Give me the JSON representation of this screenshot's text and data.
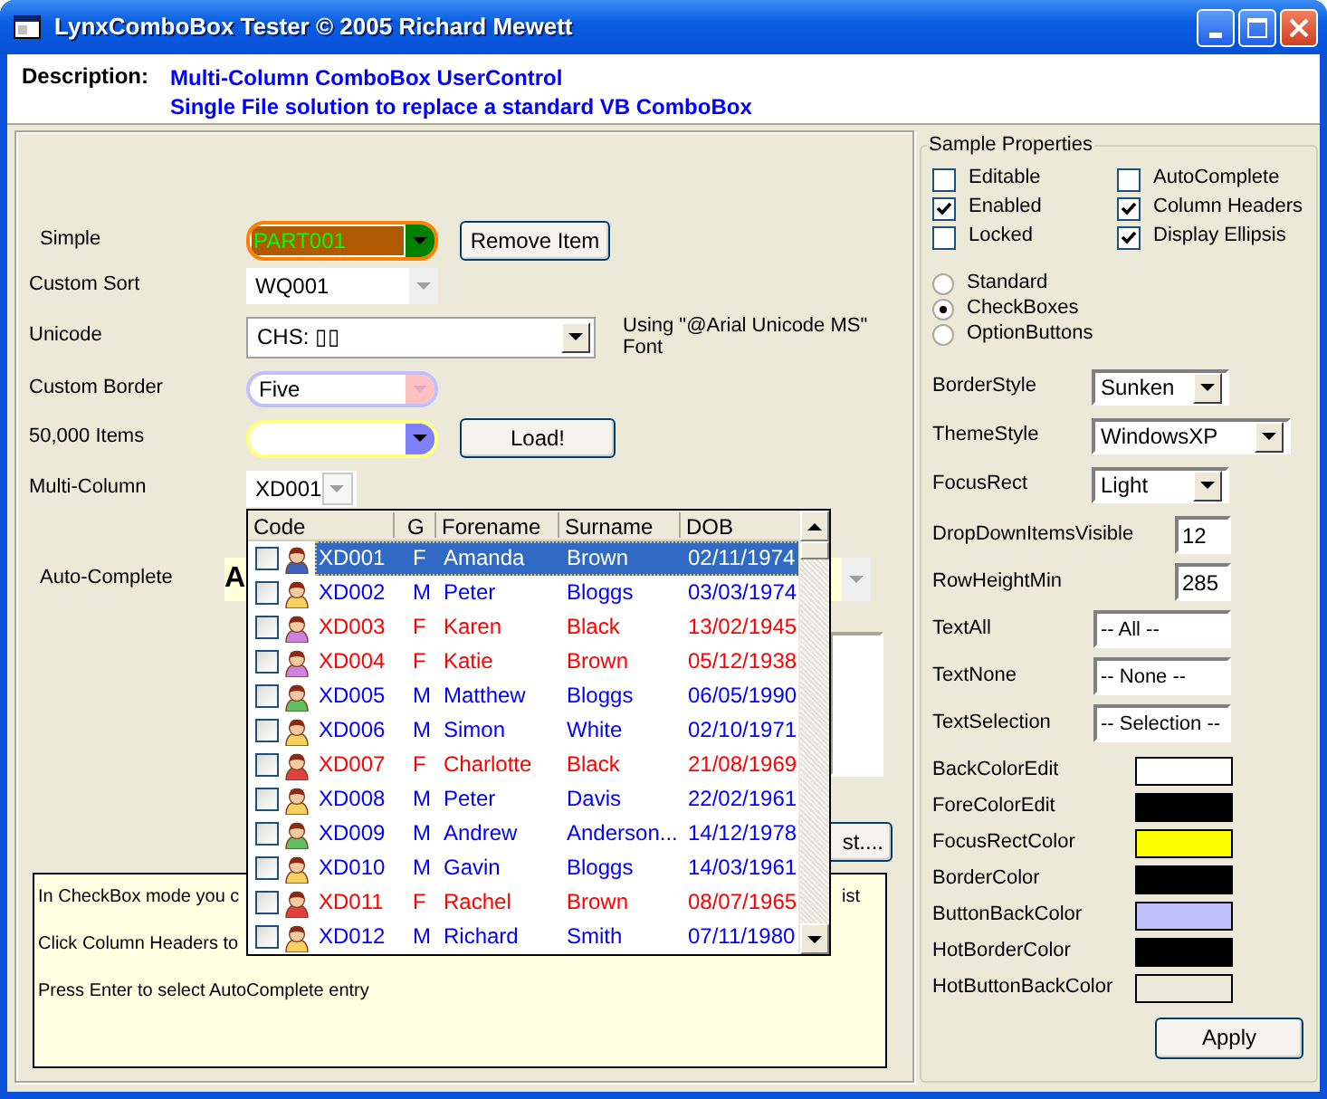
{
  "window": {
    "title": "LynxComboBox Tester © 2005 Richard Mewett"
  },
  "description": {
    "label": "Description:",
    "lines": [
      "Multi-Column ComboBox UserControl",
      "Single File solution to replace a standard VB ComboBox"
    ]
  },
  "combos": [
    {
      "kind": "simple",
      "label": "Simple",
      "value": "PART001",
      "button": "Remove Item"
    },
    {
      "kind": "sort",
      "label": "Custom Sort",
      "value": "WQ001"
    },
    {
      "kind": "unicode",
      "label": "Unicode",
      "value": "CHS: ▯▯",
      "note": "Using \"@Arial Unicode MS\" Font"
    },
    {
      "kind": "border",
      "label": "Custom Border",
      "value": "Five"
    },
    {
      "kind": "items",
      "label": "50,000 Items",
      "button": "Load!"
    },
    {
      "kind": "multi",
      "label": "Multi-Column",
      "value": "XD001"
    }
  ],
  "auto_complete": {
    "label": "Auto-Complete",
    "value": "A"
  },
  "dropdown": {
    "columns": [
      "Code",
      "G",
      "Forename",
      "Surname",
      "DOB"
    ],
    "rows": [
      {
        "code": "XD001",
        "g": "F",
        "forename": "Amanda",
        "surname": "Brown",
        "dob": "02/11/1974",
        "checked": false,
        "selected": true
      },
      {
        "code": "XD002",
        "g": "M",
        "forename": "Peter",
        "surname": "Bloggs",
        "dob": "03/03/1974",
        "color": "#0000ff",
        "checked": false,
        "selected": false
      },
      {
        "code": "XD003",
        "g": "F",
        "forename": "Karen",
        "surname": "Black",
        "dob": "13/02/1945",
        "color": "#ff0000",
        "checked": false,
        "selected": false
      },
      {
        "code": "XD004",
        "g": "F",
        "forename": "Katie",
        "surname": "Brown",
        "dob": "05/12/1938",
        "color": "#ff0000",
        "checked": false,
        "selected": false
      },
      {
        "code": "XD005",
        "g": "M",
        "forename": "Matthew",
        "surname": "Bloggs",
        "dob": "06/05/1990",
        "color": "#0000ff",
        "checked": false,
        "selected": false
      },
      {
        "code": "XD006",
        "g": "M",
        "forename": "Simon",
        "surname": "White",
        "dob": "02/10/1971",
        "color": "#0000ff",
        "checked": false,
        "selected": false
      },
      {
        "code": "XD007",
        "g": "F",
        "forename": "Charlotte",
        "surname": "Black",
        "dob": "21/08/1969",
        "color": "#ff0000",
        "checked": false,
        "selected": false
      },
      {
        "code": "XD008",
        "g": "M",
        "forename": "Peter",
        "surname": "Davis",
        "dob": "22/02/1961",
        "color": "#0000ff",
        "checked": false,
        "selected": false
      },
      {
        "code": "XD009",
        "g": "M",
        "forename": "Andrew",
        "surname": "Anderson...",
        "dob": "14/12/1978",
        "color": "#0000ff",
        "checked": false,
        "selected": false
      },
      {
        "code": "XD010",
        "g": "M",
        "forename": "Gavin",
        "surname": "Bloggs",
        "dob": "14/03/1961",
        "color": "#0000ff",
        "checked": false,
        "selected": false
      },
      {
        "code": "XD011",
        "g": "F",
        "forename": "Rachel",
        "surname": "Brown",
        "dob": "08/07/1965",
        "color": "#ff0000",
        "checked": false,
        "selected": false
      },
      {
        "code": "XD012",
        "g": "M",
        "forename": "Richard",
        "surname": "Smith",
        "dob": "07/11/1980",
        "color": "#0000ff",
        "checked": false,
        "selected": false
      }
    ]
  },
  "hidden_button": "st....",
  "notes": [
    {
      "left": "In CheckBox mode you c",
      "right": "ist"
    },
    {
      "left": "Click Column Headers to"
    },
    {
      "left": "Press Enter to select AutoComplete entry"
    }
  ],
  "properties": {
    "title": "Sample Properties",
    "checkboxes": [
      {
        "label": "Editable",
        "checked": false
      },
      {
        "label": "AutoComplete",
        "checked": false
      },
      {
        "label": "Enabled",
        "checked": true
      },
      {
        "label": "Column Headers",
        "checked": true
      },
      {
        "label": "Locked",
        "checked": false
      },
      {
        "label": "Display Ellipsis",
        "checked": true
      }
    ],
    "radios": [
      {
        "label": "Standard",
        "selected": false
      },
      {
        "label": "CheckBoxes",
        "selected": true
      },
      {
        "label": "OptionButtons",
        "selected": false
      }
    ],
    "selects": [
      {
        "kind": "narrow",
        "label": "BorderStyle",
        "value": "Sunken"
      },
      {
        "kind": "wide",
        "label": "ThemeStyle",
        "value": "WindowsXP"
      },
      {
        "kind": "narrow",
        "label": "FocusRect",
        "value": "Light"
      }
    ],
    "fields": [
      {
        "kind": "short",
        "label": "DropDownItemsVisible",
        "value": "12"
      },
      {
        "kind": "short",
        "label": "RowHeightMin",
        "value": "285"
      },
      {
        "kind": "long",
        "label": "TextAll",
        "value": "-- All --"
      },
      {
        "kind": "long",
        "label": "TextNone",
        "value": "-- None --"
      },
      {
        "kind": "long",
        "label": "TextSelection",
        "value": "-- Selection --"
      }
    ],
    "colors": [
      {
        "label": "BackColorEdit",
        "color": "#ffffff"
      },
      {
        "label": "ForeColorEdit",
        "color": "#000000"
      },
      {
        "label": "FocusRectColor",
        "color": "#ffff00"
      },
      {
        "label": "BorderColor",
        "color": "#000000"
      },
      {
        "label": "ButtonBackColor",
        "color": "#c0c0ff"
      },
      {
        "label": "HotBorderColor",
        "color": "#000000"
      },
      {
        "label": "HotButtonBackColor",
        "color": "#ece9d8"
      }
    ],
    "apply": "Apply"
  }
}
